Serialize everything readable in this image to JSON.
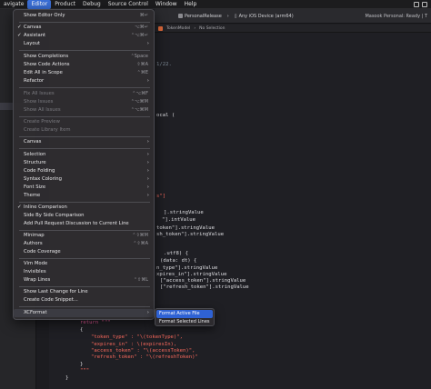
{
  "menubar": {
    "items": [
      "avigate",
      "Editor",
      "Product",
      "Debug",
      "Source Control",
      "Window",
      "Help"
    ],
    "active_index": 1
  },
  "toolbar": {
    "scheme": "PersonalRelease",
    "destination": "Any iOS Device (arm64)",
    "status": "Masook Personal: Ready | T"
  },
  "jumpbar": {
    "file": "TokenModel",
    "symbol": "No Selection"
  },
  "editor_menu": {
    "items": [
      {
        "label": "Show Editor Only",
        "shortcut": "⌘↵"
      },
      {
        "label": "Canvas",
        "checked": true,
        "shortcut": "⌥⌘↵"
      },
      {
        "label": "Assistant",
        "checked": true,
        "shortcut": "⌃⌥⌘↵"
      },
      {
        "label": "Layout",
        "submenu": true
      },
      {
        "label": "Show Completions",
        "shortcut": "⌃Space"
      },
      {
        "label": "Show Code Actions",
        "shortcut": "⇧⌘A"
      },
      {
        "label": "Edit All in Scope",
        "shortcut": "⌃⌘E"
      },
      {
        "label": "Refactor",
        "submenu": true
      },
      {
        "label": "Fix All Issues",
        "disabled": true,
        "shortcut": "⌃⌥⌘F"
      },
      {
        "label": "Show Issues",
        "disabled": true,
        "shortcut": "⌃⌥⌘M"
      },
      {
        "label": "Show All Issues",
        "disabled": true,
        "shortcut": "⌃⌥⌘M"
      },
      {
        "label": "Create Preview",
        "disabled": true
      },
      {
        "label": "Create Library Item",
        "disabled": true
      },
      {
        "label": "Canvas",
        "submenu": true
      },
      {
        "label": "Selection",
        "submenu": true
      },
      {
        "label": "Structure",
        "submenu": true
      },
      {
        "label": "Code Folding",
        "submenu": true
      },
      {
        "label": "Syntax Coloring",
        "submenu": true
      },
      {
        "label": "Font Size",
        "submenu": true
      },
      {
        "label": "Theme",
        "submenu": true
      },
      {
        "label": "Inline Comparison",
        "checked": true
      },
      {
        "label": "Side By Side Comparison"
      },
      {
        "label": "Add Pull Request Discussion to Current Line"
      },
      {
        "label": "Minimap",
        "shortcut": "⌃⇧⌘M"
      },
      {
        "label": "Authors",
        "shortcut": "⌃⇧⌘A"
      },
      {
        "label": "Code Coverage"
      },
      {
        "label": "Vim Mode"
      },
      {
        "label": "Invisibles"
      },
      {
        "label": "Wrap Lines",
        "shortcut": "⌃⇧⌘L"
      },
      {
        "label": "Show Last Change for Line"
      },
      {
        "label": "Create Code Snippet..."
      },
      {
        "label": "XCFormat",
        "submenu": true,
        "highlighted": true
      }
    ]
  },
  "xcformat_submenu": {
    "items": [
      {
        "label": "Format Active File",
        "selected": true
      },
      {
        "label": "Format Selected Lines"
      }
    ]
  },
  "code_fragments": [
    "1/22.",
    "ocal (",
    "s\"]",
    "].stringValue",
    "\"].intValue",
    "token\"].stringValue",
    "sh_token\"].stringValue",
    ".utf8) {",
    "(data: dt) {",
    "n_type\"].stringValue",
    "xpires_in\"].stringValue",
    "[\"access_token\"].stringValue",
    "[\"refresh_token\"].stringValue",
    "return \"\"\"",
    "{",
    "\"token_type\" : \"\\(tokenType)\",",
    "\"expires_in\" : \\(expiresIn),",
    "\"access_token\" : \"\\(accessToken)\",",
    "\"refresh_token\" : \"\\(refreshToken)\"",
    "}",
    "\"\"\"",
    "}"
  ]
}
